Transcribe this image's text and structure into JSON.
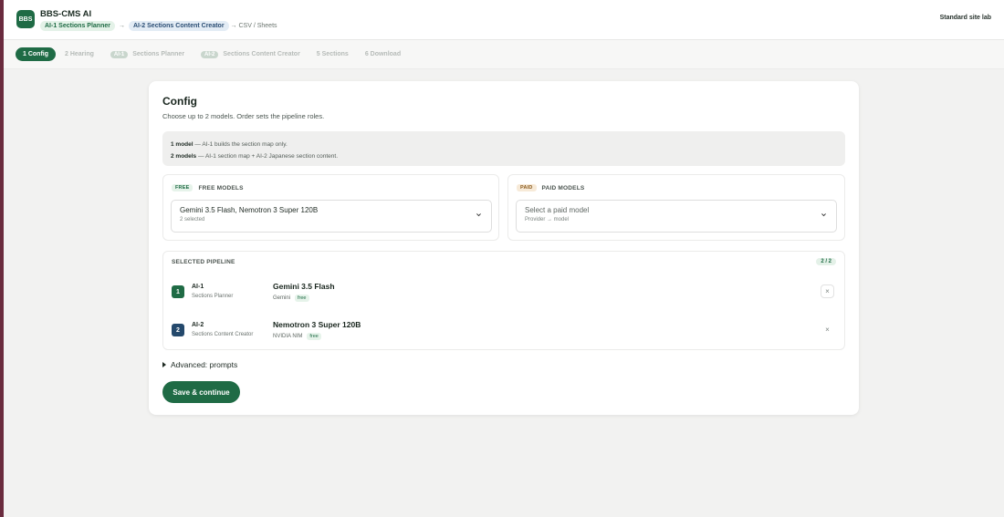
{
  "header": {
    "logo_text": "BBS",
    "app_title": "BBS-CMS AI",
    "flow_step1": "AI-1 Sections Planner",
    "flow_step2": "AI-2 Sections Content Creator",
    "flow_arrow": "→",
    "flow_tail": "→ CSV / Sheets",
    "right_link": "Standard site lab"
  },
  "steps": {
    "items": [
      {
        "label": "1 Config",
        "active": true
      },
      {
        "label": "2 Hearing"
      },
      {
        "chip": "AI-1",
        "label": "Sections Planner"
      },
      {
        "chip": "AI-2",
        "label": "Sections Content Creator"
      },
      {
        "label": "5 Sections"
      },
      {
        "label": "6 Download"
      }
    ]
  },
  "card": {
    "title": "Config",
    "subtitle": "Choose up to 2 models. Order sets the pipeline roles.",
    "info_line1_bold": "1 model",
    "info_line1_rest": " — AI-1 builds the section map only.",
    "info_line2_bold": "2 models",
    "info_line2_rest": " — AI-1 section map + AI-2 Japanese section content."
  },
  "free_models": {
    "tag": "FREE",
    "heading": "FREE MODELS",
    "selected_value": "Gemini 3.5 Flash, Nemotron 3 Super 120B",
    "selected_sub": "2 selected"
  },
  "paid_models": {
    "tag": "PAID",
    "heading": "PAID MODELS",
    "placeholder": "Select a paid model",
    "sub": "Provider → model"
  },
  "pipeline": {
    "heading": "SELECTED PIPELINE",
    "count": "2 / 2",
    "rows": [
      {
        "num": "1",
        "role": "AI-1",
        "role_sub": "Sections Planner",
        "model": "Gemini 3.5 Flash",
        "provider": "Gemini",
        "tier": "free",
        "remove": "×"
      },
      {
        "num": "2",
        "role": "AI-2",
        "role_sub": "Sections Content Creator",
        "model": "Nemotron 3 Super 120B",
        "provider": "NVIDIA NIM",
        "tier": "free",
        "remove": "×"
      }
    ]
  },
  "advanced_label": "Advanced: prompts",
  "save_label": "Save & continue",
  "colors": {
    "accent": "#1f6b45",
    "ai2_blue": "#24496c",
    "background": "#f2f2f1"
  }
}
